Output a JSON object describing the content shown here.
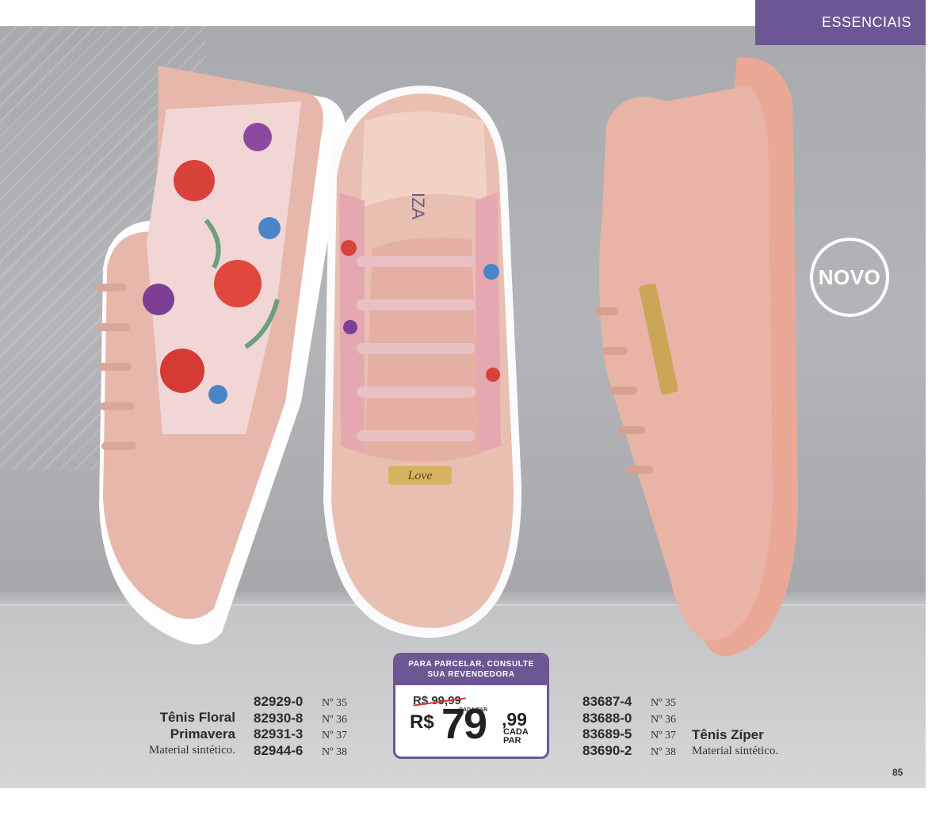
{
  "header": {
    "section": "ESSENCIAIS"
  },
  "badge": {
    "label": "NOVO"
  },
  "shoe_logos": {
    "love_tag": "Love",
    "insole_brand": "IZA"
  },
  "product_left": {
    "name_line1": "Tênis Floral",
    "name_line2": "Primavera",
    "material": "Material sintético.",
    "codes": [
      {
        "code": "82929-0",
        "size": "Nº 35"
      },
      {
        "code": "82930-8",
        "size": "Nº 36"
      },
      {
        "code": "82931-3",
        "size": "Nº 37"
      },
      {
        "code": "82944-6",
        "size": "Nº 38"
      }
    ]
  },
  "product_right": {
    "name": "Tênis Zíper",
    "material": "Material sintético.",
    "codes": [
      {
        "code": "83687-4",
        "size": "Nº 35"
      },
      {
        "code": "83688-0",
        "size": "Nº 36"
      },
      {
        "code": "83689-5",
        "size": "Nº 37"
      },
      {
        "code": "83690-2",
        "size": "Nº 38"
      }
    ]
  },
  "price": {
    "header_line1": "PARA PARCELAR, CONSULTE",
    "header_line2": "SUA REVENDEDORA",
    "old_price": "R$ 99,99",
    "old_cada": "CADA PAR",
    "currency": "R$",
    "new_int": "79",
    "new_dec": ",99",
    "new_cada_line1": "CADA",
    "new_cada_line2": "PAR"
  },
  "page_number": "85",
  "colors": {
    "accent": "#6c5694",
    "shoe_pink": "#e8b9ad",
    "sole_pink": "#e9a996",
    "strike": "#d63a3a"
  }
}
